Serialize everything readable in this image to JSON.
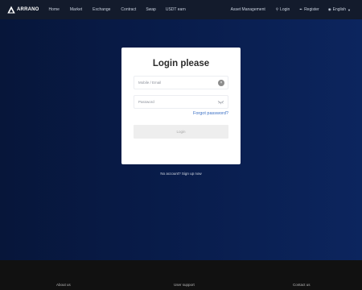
{
  "brand": {
    "name": "ARRANO"
  },
  "nav": {
    "items": [
      "Home",
      "Market",
      "Exchange",
      "Contract",
      "Swap",
      "USDT earn"
    ],
    "asset_management": "Asset Management",
    "login": "Login",
    "register": "Register",
    "language": "English"
  },
  "login_form": {
    "title": "Login please",
    "account_placeholder": "Mobile / Email",
    "password_placeholder": "Password",
    "forgot_password": "Forgot password?",
    "login_button": "Login"
  },
  "signup_prompt": "No account? Sign up now",
  "footer": {
    "columns": [
      "About us",
      "User support",
      "Contact us"
    ]
  },
  "colors": {
    "nav_background": "#131b2c",
    "main_gradient_start": "#07163a",
    "main_gradient_end": "#0c255e",
    "link_accent": "#3a6fc4",
    "footer_background": "#111111"
  },
  "icons": {
    "logo": "triangle-logo-icon",
    "login": "user-icon",
    "register": "pencil-icon",
    "language": "globe-icon",
    "language_dropdown": "caret-down-icon",
    "clear_field": "clear-circle-icon",
    "password_visibility": "eye-closed-icon"
  }
}
